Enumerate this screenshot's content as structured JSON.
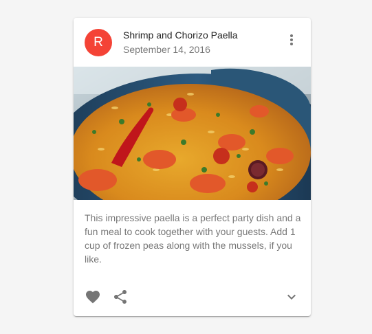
{
  "card": {
    "avatar_letter": "R",
    "avatar_color": "#f44336",
    "title": "Shrimp and Chorizo Paella",
    "subheader": "September 14, 2016",
    "media_icon": "paella-dish-photo",
    "body": "This impressive paella is a perfect party dish and a fun meal to cook together with your guests. Add 1 cup of frozen peas along with the mussels, if you like.",
    "icons": {
      "more": "more-vert-icon",
      "favorite": "favorite-icon",
      "share": "share-icon",
      "expand": "expand-more-icon"
    },
    "icon_color": "#757575"
  }
}
